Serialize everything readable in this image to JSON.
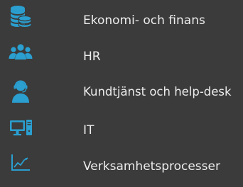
{
  "colors": {
    "background": "#3b3b3b",
    "icon": "#2a9fd0",
    "text": "#ececec"
  },
  "menu": {
    "items": [
      {
        "label": "Ekonomi- och finans",
        "icon": "coins-icon"
      },
      {
        "label": "HR",
        "icon": "people-icon"
      },
      {
        "label": "Kundtjänst och help-desk",
        "icon": "headset-support-icon"
      },
      {
        "label": "IT",
        "icon": "computer-icon"
      },
      {
        "label": "Verksamhetsprocesser",
        "icon": "chart-trend-icon"
      }
    ]
  }
}
